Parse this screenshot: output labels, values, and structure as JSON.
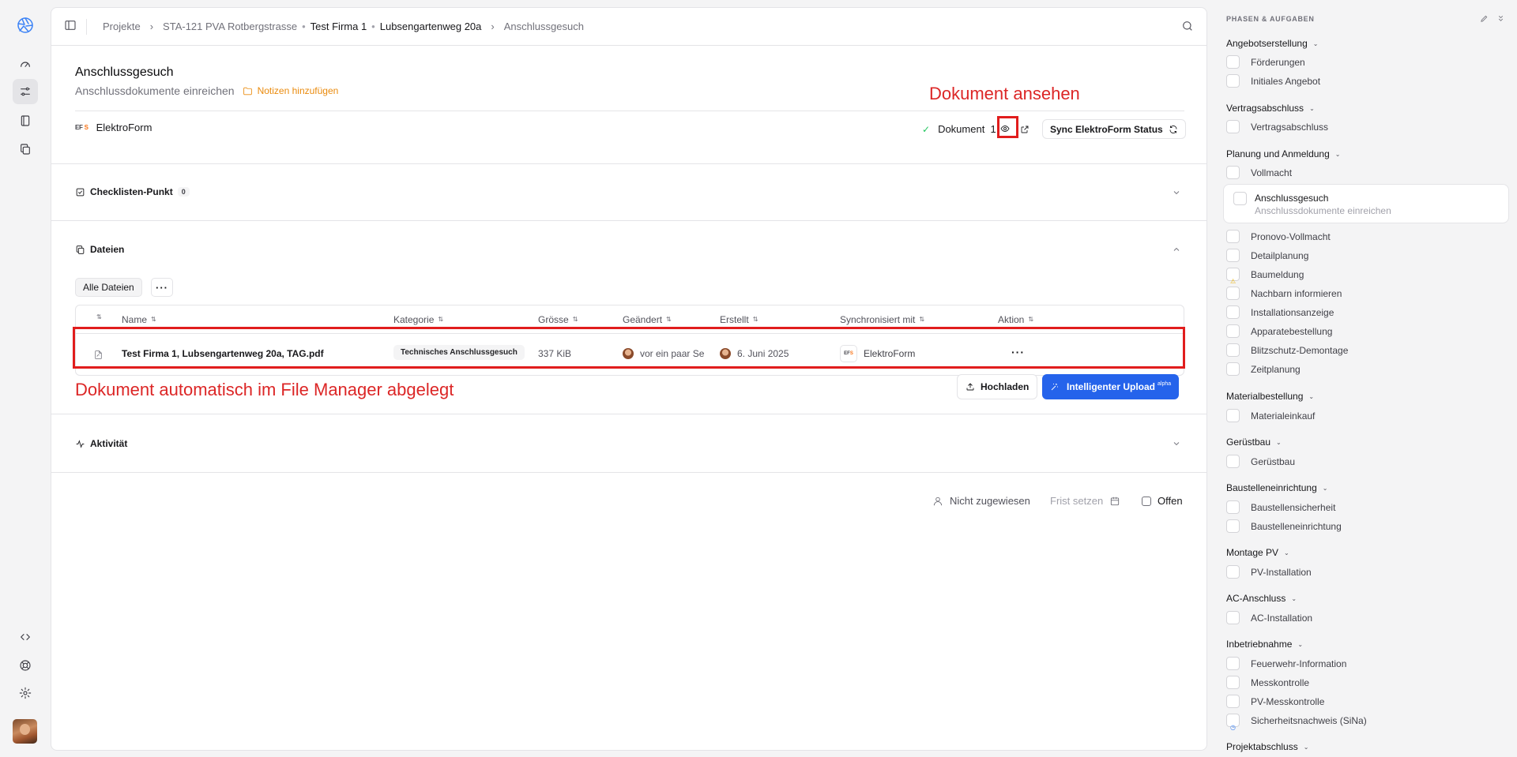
{
  "breadcrumb": {
    "items": [
      "Projekte",
      "STA-121 PVA Rotbergstrasse"
    ],
    "company": "Test Firma 1",
    "address": "Lubsengartenweg 20a",
    "current": "Anschlussgesuch"
  },
  "task": {
    "title": "Anschlussgesuch",
    "subtitle": "Anschlussdokumente einreichen",
    "notes_label": "Notizen hinzufügen"
  },
  "annotations": {
    "view_doc": "Dokument ansehen",
    "file_manager": "Dokument automatisch im File Manager abgelegt"
  },
  "integration": {
    "logo_text": "EF",
    "logo_accent": "S",
    "name": "ElektroForm",
    "doc_label": "Dokument",
    "doc_count": "1",
    "sync_label": "Sync ElektroForm Status"
  },
  "checklist": {
    "label": "Checklisten-Punkt",
    "count": "0"
  },
  "files": {
    "section_label": "Dateien",
    "tab_all": "Alle Dateien",
    "more": "···",
    "columns": {
      "name": "Name",
      "category": "Kategorie",
      "size": "Grösse",
      "changed": "Geändert",
      "created": "Erstellt",
      "synced": "Synchronisiert mit",
      "action": "Aktion"
    },
    "rows": [
      {
        "name": "Test Firma 1, Lubsengartenweg 20a, TAG.pdf",
        "category": "Technisches Anschlussgesuch",
        "size": "337 KiB",
        "changed": "vor ein paar Se",
        "created": "6. Juni 2025",
        "synced": "ElektroForm",
        "menu": "···"
      }
    ],
    "upload_label": "Hochladen",
    "smart_upload_label": "Intelligenter Upload",
    "smart_upload_badge": "alpha"
  },
  "activity": {
    "label": "Aktivität"
  },
  "footer": {
    "assignee": "Nicht zugewiesen",
    "deadline": "Frist setzen",
    "status": "Offen"
  },
  "right_panel": {
    "heading": "PHASEN & AUFGABEN",
    "phases": [
      {
        "name": "Angebotserstellung",
        "tasks": [
          "Förderungen",
          "Initiales Angebot"
        ]
      },
      {
        "name": "Vertragsabschluss",
        "tasks": [
          "Vertragsabschluss"
        ]
      },
      {
        "name": "Planung und Anmeldung",
        "tasks": [
          "Vollmacht",
          "Anschlussgesuch",
          "Pronovo-Vollmacht",
          "Detailplanung",
          "Baumeldung",
          "Nachbarn informieren",
          "Installationsanzeige",
          "Apparatebestellung",
          "Blitzschutz-Demontage",
          "Zeitplanung"
        ]
      },
      {
        "name": "Materialbestellung",
        "tasks": [
          "Materialeinkauf"
        ]
      },
      {
        "name": "Gerüstbau",
        "tasks": [
          "Gerüstbau"
        ]
      },
      {
        "name": "Baustelleneinrichtung",
        "tasks": [
          "Baustellensicherheit",
          "Baustelleneinrichtung"
        ]
      },
      {
        "name": "Montage PV",
        "tasks": [
          "PV-Installation"
        ]
      },
      {
        "name": "AC-Anschluss",
        "tasks": [
          "AC-Installation"
        ]
      },
      {
        "name": "Inbetriebnahme",
        "tasks": [
          "Feuerwehr-Information",
          "Messkontrolle",
          "PV-Messkontrolle",
          "Sicherheitsnachweis (SiNa)"
        ]
      },
      {
        "name": "Projektabschluss",
        "tasks": []
      }
    ],
    "active_task_sub": "Anschlussdokumente einreichen"
  },
  "colors": {
    "accent_blue": "#2563eb",
    "annotation_red": "#dc2626",
    "notes_orange": "#ea8a0c"
  }
}
